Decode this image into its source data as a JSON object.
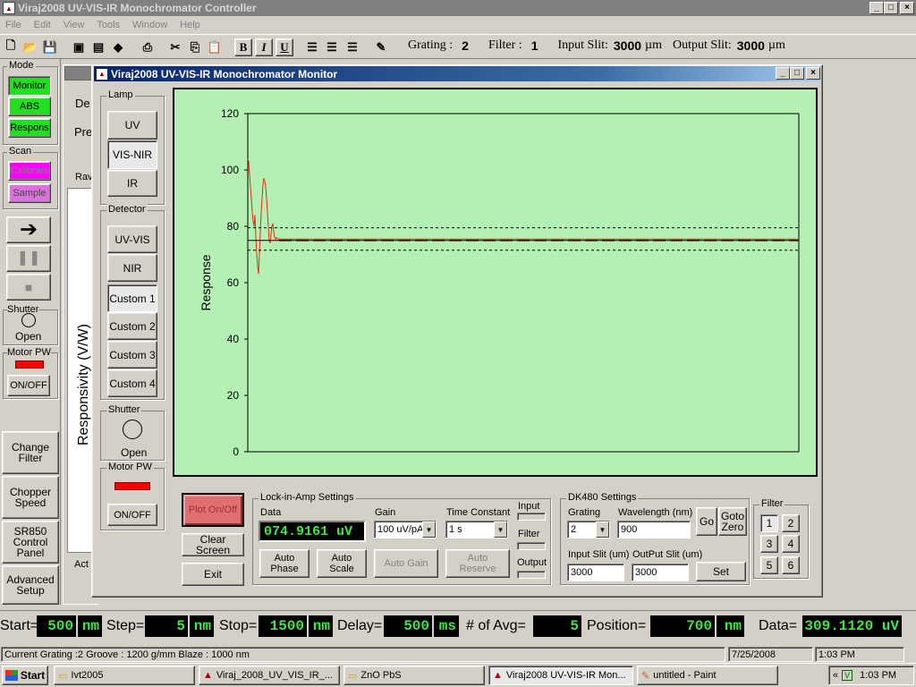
{
  "main_window": {
    "title": "Viraj2008 UV-VIS-IR Monochromator Controller",
    "menu": [
      "File",
      "Edit",
      "View",
      "Tools",
      "Window",
      "Help"
    ],
    "toolbar_info": {
      "grating_label": "Grating :",
      "grating_value": "2",
      "filter_label": "Filter :",
      "filter_value": "1",
      "input_slit_label": "Input Slit:",
      "input_slit_value": "3000",
      "input_slit_unit": "µm",
      "output_slit_label": "Output Slit:",
      "output_slit_value": "3000",
      "output_slit_unit": "µm"
    }
  },
  "left_panel": {
    "mode_label": "Mode",
    "mode_buttons": [
      "Monitor",
      "ABS",
      "Respons"
    ],
    "scan_label": "Scan",
    "scan_buttons": [
      "Calibrate",
      "Sample"
    ],
    "shutter_label": "Shutter",
    "shutter_state": "Open",
    "motor_label": "Motor PW",
    "onoff_label": "ON/OFF",
    "bottom_buttons": [
      "Change Filter",
      "Chopper Speed",
      "SR850 Control Panel",
      "Advanced Setup"
    ]
  },
  "background_window": {
    "partial_labels": [
      "De",
      "Pre",
      "Rav",
      "Act"
    ],
    "y_axis_label": "Responsivity (V/W)"
  },
  "monitor_window": {
    "title": "Viraj2008 UV-VIS-IR Monochromator Monitor",
    "lamp_label": "Lamp",
    "lamp_buttons": [
      "UV",
      "VIS-NIR",
      "IR"
    ],
    "detector_label": "Detector",
    "detector_buttons": [
      "UV-VIS",
      "NIR",
      "Custom 1",
      "Custom 2",
      "Custom 3",
      "Custom 4"
    ],
    "shutter_label": "Shutter",
    "shutter_state": "Open",
    "motor_label": "Motor PW",
    "onoff_label": "ON/OFF",
    "plot_onoff": "Plot On/Off",
    "clear_screen": "Clear Screen",
    "exit": "Exit",
    "lockin": {
      "title": "Lock-in-Amp Settings",
      "data_label": "Data",
      "data_value": "074.9161 uV",
      "gain_label": "Gain",
      "gain_value": "100 uV/pA",
      "tc_label": "Time Constant",
      "tc_value": "1 s",
      "input_label": "Input",
      "filter_label": "Filter",
      "output_label": "Output",
      "auto_phase": "Auto Phase",
      "auto_scale": "Auto Scale",
      "auto_gain": "Auto Gain",
      "auto_reserve": "Auto Reserve"
    },
    "dk480": {
      "title": "DK480 Settings",
      "grating_label": "Grating",
      "grating_value": "2",
      "wavelength_label": "Wavelength (nm)",
      "wavelength_value": "900",
      "go": "Go",
      "goto_zero": "Goto Zero",
      "input_slit_label": "Input Slit (um)",
      "input_slit_value": "3000",
      "output_slit_label": "OutPut Slit (um)",
      "output_slit_value": "3000",
      "set": "Set"
    },
    "filter": {
      "title": "Filter",
      "buttons": [
        "1",
        "2",
        "3",
        "4",
        "5",
        "6"
      ]
    }
  },
  "chart_data": {
    "type": "line",
    "title": "",
    "xlabel": "",
    "ylabel": "Response",
    "ylim": [
      0,
      120
    ],
    "yticks": [
      0,
      20,
      40,
      60,
      80,
      100,
      120
    ],
    "grid": false,
    "series": [
      {
        "style": "solid",
        "color": "#e03010",
        "x": [
          0,
          1,
          2,
          3,
          4,
          5,
          6,
          7,
          8,
          9,
          10,
          11,
          12,
          13,
          14,
          15,
          16,
          17,
          18,
          19,
          20,
          21,
          22,
          23,
          24,
          25,
          26,
          27,
          28,
          29,
          30,
          31,
          32,
          33,
          34,
          35,
          36,
          37,
          38,
          39,
          40,
          45,
          50,
          60,
          80,
          100,
          150,
          200,
          250,
          300,
          350,
          400,
          450,
          500,
          550,
          600,
          615
        ],
        "y": [
          104,
          103,
          98,
          94,
          90,
          85,
          82,
          80,
          84,
          76,
          70,
          66,
          63,
          70,
          78,
          85,
          90,
          95,
          97,
          96,
          94,
          90,
          85,
          80,
          75,
          74,
          77,
          80,
          81,
          78,
          76,
          75.5,
          76,
          75.8,
          75.5,
          75.6,
          75.4,
          75.5,
          75.5,
          75.5,
          75.5,
          75.5,
          75.5,
          75.5,
          75.5,
          75.5,
          75.5,
          75.5,
          75.5,
          75.5,
          75.5,
          75.5,
          75.5,
          75.5,
          75.5,
          75.5,
          75.5
        ]
      },
      {
        "style": "dashed",
        "color": "#000000",
        "x": [
          0,
          615
        ],
        "y": [
          79.5,
          79.5
        ]
      },
      {
        "style": "dashed",
        "color": "#000000",
        "x": [
          0,
          615
        ],
        "y": [
          71.5,
          71.5
        ]
      },
      {
        "style": "long-dash",
        "color": "#c02010",
        "x": [
          35,
          615
        ],
        "y": [
          75,
          75
        ]
      },
      {
        "style": "solid",
        "color": "#000000",
        "x": [
          0,
          615
        ],
        "y": [
          75,
          75
        ]
      }
    ]
  },
  "status_row": {
    "start_label": "Start=",
    "start_value": "500",
    "start_unit": "nm",
    "step_label": "Step=",
    "step_value": "5",
    "step_unit": "nm",
    "stop_label": "Stop=",
    "stop_value": "1500",
    "stop_unit": "nm",
    "delay_label": "Delay=",
    "delay_value": "500",
    "delay_unit": "ms",
    "avg_label": "# of Avg=",
    "avg_value": "5",
    "position_label": "Position=",
    "position_value": "700",
    "position_unit": "nm",
    "data_label": "Data=",
    "data_value": "309.1120 uV"
  },
  "statusbar": {
    "text": "Current Grating :2  Groove : 1200 g/mm  Blaze : 1000 nm",
    "date": "7/25/2008",
    "time": "1:03 PM"
  },
  "taskbar": {
    "start": "Start",
    "items": [
      "Ivt2005",
      "Viraj_2008_UV_VIS_IR_...",
      "ZnO PbS",
      "Viraj2008 UV-VIS-IR Mon...",
      "untitled - Paint"
    ],
    "tray_time": "1:03 PM",
    "tray_chevron": "«"
  },
  "colors": {
    "titlebar_active": "#0a246a",
    "titlebar_inactive": "#808080",
    "plot_bg": "#b4f0b4",
    "lcd_fg": "#3ee83e",
    "mode_green": "#20e020",
    "scan_magenta": "#ff00ff",
    "motor_red": "#ff0000"
  }
}
